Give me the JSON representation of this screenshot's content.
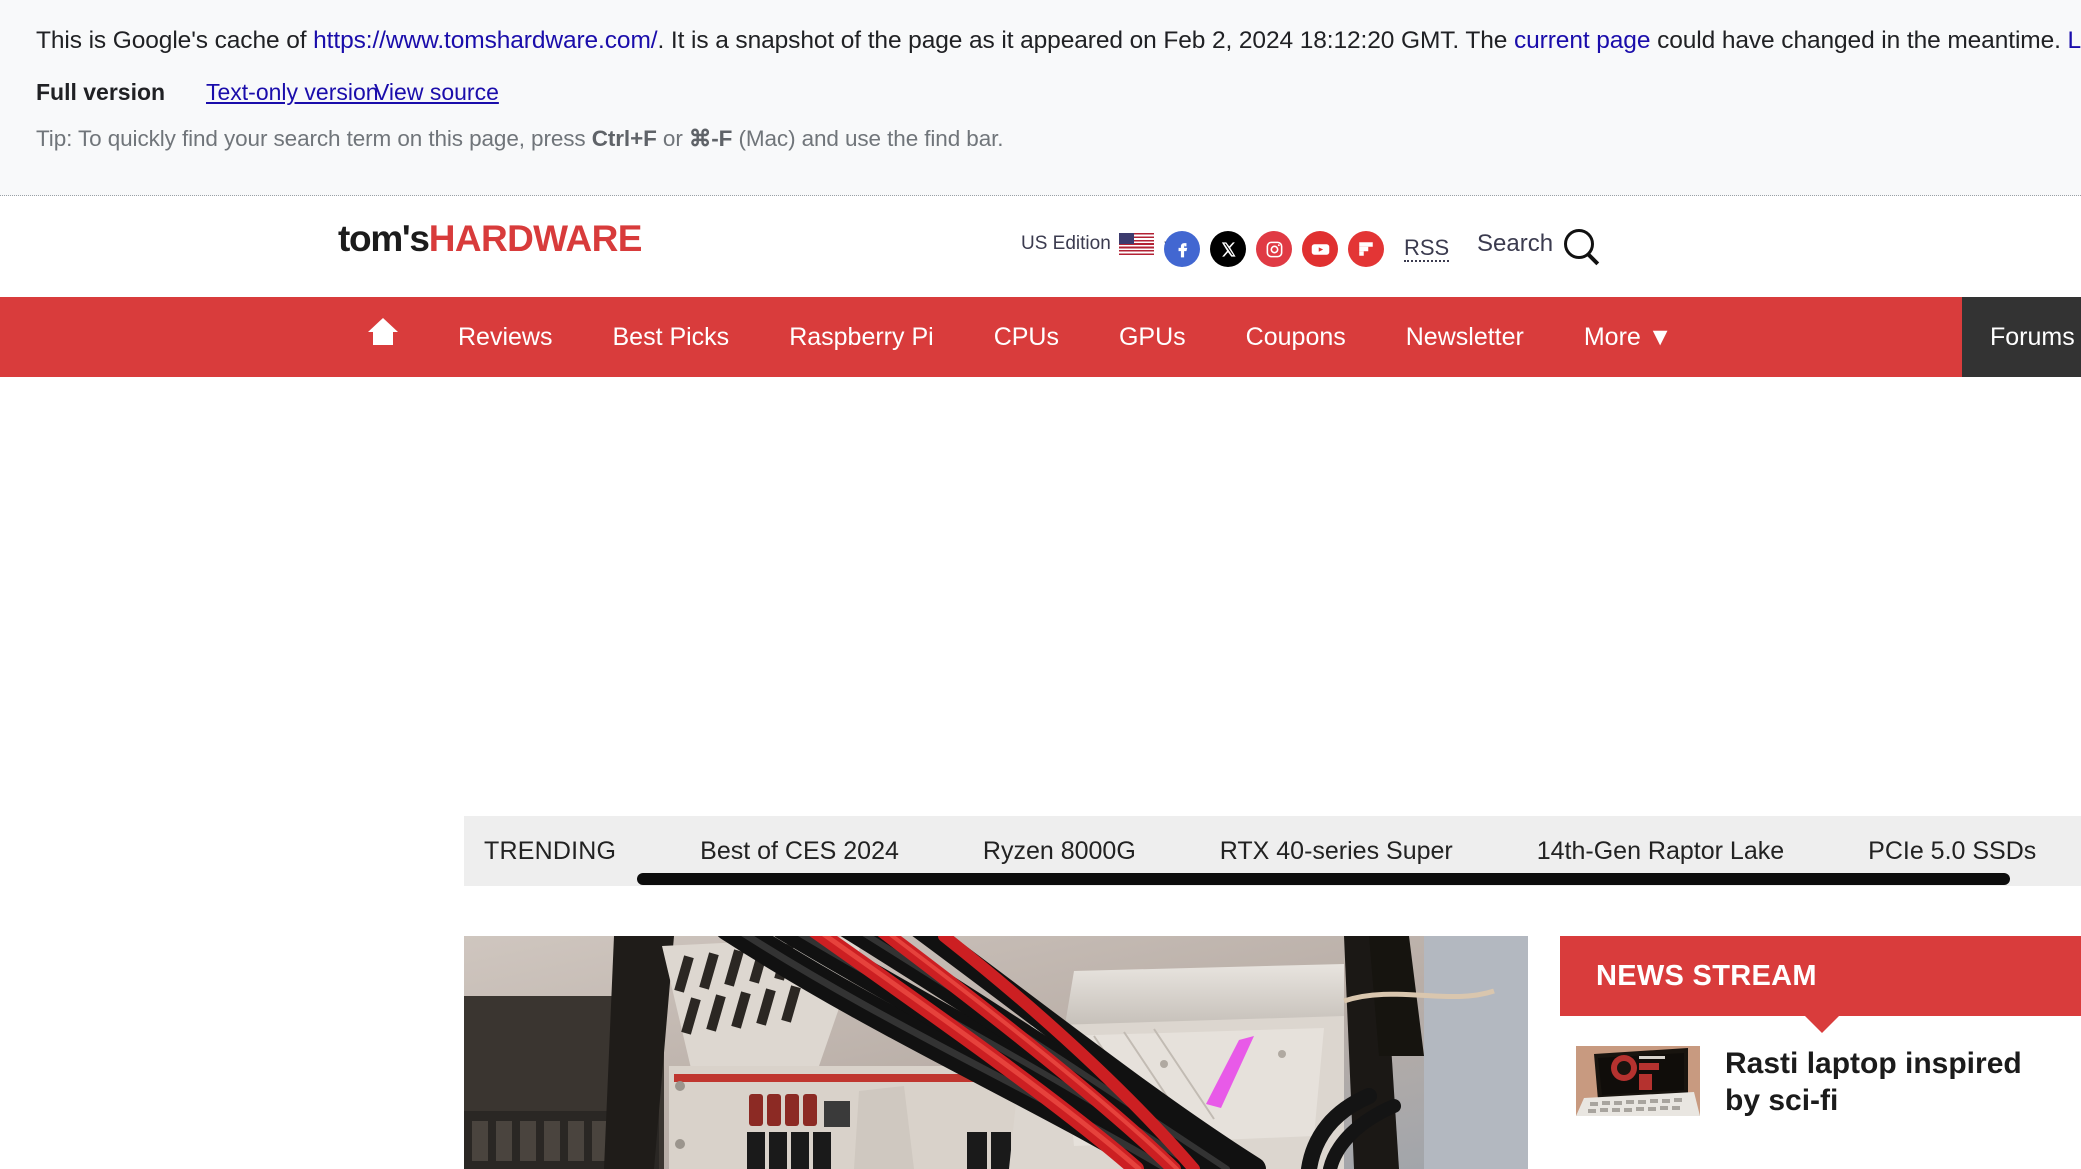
{
  "cache_banner": {
    "intro": "This is Google's cache of ",
    "cached_url": "https://www.tomshardware.com/",
    "middle": ". It is a snapshot of the page as it appeared on Feb 2, 2024 18:12:20 GMT. The ",
    "current_page_link": "current page",
    "after": " could have changed in the meantime. ",
    "learn_more": "Learn more.",
    "full_version": "Full version",
    "text_only_version": "Text-only version",
    "view_source": "View source",
    "tip_prefix": "Tip: To quickly find your search term on this page, press ",
    "tip_key1": "Ctrl+F",
    "tip_or": " or ",
    "tip_key2": "⌘-F",
    "tip_suffix": " (Mac) and use the find bar."
  },
  "header": {
    "logo_part1": "tom's",
    "logo_part2": "HARDWARE",
    "edition_label": "US Edition",
    "edition_caret": "▼",
    "search_label": "Search",
    "rss_label": "RSS",
    "socials": [
      {
        "name": "facebook",
        "glyph": "f"
      },
      {
        "name": "x-twitter",
        "glyph": "𝕏"
      },
      {
        "name": "instagram",
        "glyph": "□"
      },
      {
        "name": "youtube",
        "glyph": "▶"
      },
      {
        "name": "flipboard",
        "glyph": "▐"
      }
    ]
  },
  "nav": {
    "home_label": "",
    "items": [
      {
        "label": "Reviews"
      },
      {
        "label": "Best Picks"
      },
      {
        "label": "Raspberry Pi"
      },
      {
        "label": "CPUs"
      },
      {
        "label": "GPUs"
      },
      {
        "label": "Coupons"
      },
      {
        "label": "Newsletter"
      },
      {
        "label": "More ▼"
      }
    ],
    "forums_label": "Forums"
  },
  "trending": {
    "label": "TRENDING",
    "items": [
      {
        "label": "Best of CES 2024"
      },
      {
        "label": "Ryzen 8000G"
      },
      {
        "label": "RTX 40-series Super"
      },
      {
        "label": "14th-Gen Raptor Lake"
      },
      {
        "label": "PCIe 5.0 SSDs"
      }
    ]
  },
  "news_stream": {
    "title": "NEWS STREAM",
    "items": [
      {
        "headline": "Rasti laptop inspired by sci-fi"
      }
    ]
  },
  "colors": {
    "brand_red": "#d93c3c",
    "nav_red": "#d93c3c",
    "forums_dark": "#333333",
    "link_blue": "#1a0dab",
    "banner_bg": "#f8f9fa",
    "trending_bg": "#eeeeee"
  }
}
